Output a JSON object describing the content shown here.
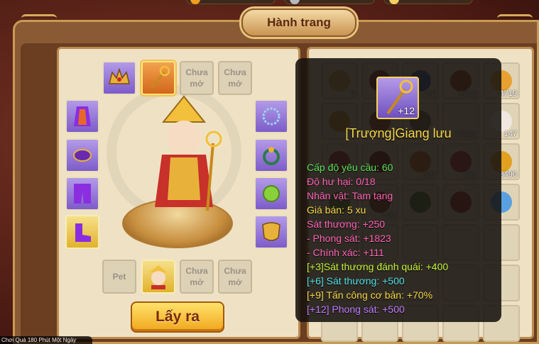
{
  "window": {
    "title": "Hành trang"
  },
  "equipment": {
    "locked_label": "Chưa mở",
    "pet_label": "Pet",
    "take_out_button": "Lấy ra",
    "slots": [
      {
        "id": "crown",
        "state": "filled",
        "icon": "crown-icon"
      },
      {
        "id": "staff",
        "state": "selected",
        "icon": "staff-icon"
      },
      {
        "id": "locked-1",
        "state": "locked"
      },
      {
        "id": "locked-2",
        "state": "locked"
      },
      {
        "id": "robe",
        "state": "filled",
        "icon": "robe-icon"
      },
      {
        "id": "belt",
        "state": "filled",
        "icon": "belt-icon"
      },
      {
        "id": "pants",
        "state": "filled",
        "icon": "pants-icon"
      },
      {
        "id": "boots",
        "state": "gold",
        "icon": "boots-icon"
      },
      {
        "id": "necklace",
        "state": "filled",
        "icon": "necklace-icon"
      },
      {
        "id": "ring",
        "state": "filled",
        "icon": "ring-icon"
      },
      {
        "id": "charm",
        "state": "filled",
        "icon": "charm-icon"
      },
      {
        "id": "mask",
        "state": "filled",
        "icon": "mask-icon"
      },
      {
        "id": "pet",
        "state": "pet"
      },
      {
        "id": "portrait",
        "state": "portrait",
        "icon": "character-portrait-icon"
      },
      {
        "id": "locked-3",
        "state": "locked"
      },
      {
        "id": "locked-4",
        "state": "locked"
      }
    ]
  },
  "bag": {
    "cells": [
      {
        "count": "0",
        "icon": "bowl-icon"
      },
      {
        "count": "",
        "icon": "scroll-icon"
      },
      {
        "count": "245",
        "icon": "cloth-icon"
      },
      {
        "count": "4316",
        "icon": "meat-icon"
      },
      {
        "count": "4719",
        "icon": "ginger-icon"
      },
      {
        "count": "0",
        "icon": "bowl-icon"
      },
      {
        "count": "",
        "icon": "item-icon"
      },
      {
        "count": "",
        "icon": "item-icon"
      },
      {
        "count": "10816",
        "icon": "bun-icon"
      },
      {
        "count": "147",
        "icon": "rice-bag-icon"
      },
      {
        "count": "",
        "icon": "item-icon"
      },
      {
        "count": "",
        "icon": "item-icon"
      },
      {
        "count": "307",
        "icon": "card-icon"
      },
      {
        "count": "233",
        "icon": "new-card-icon"
      },
      {
        "count": "3490",
        "icon": "gourd-icon"
      },
      {
        "count": "",
        "icon": "item-icon"
      },
      {
        "count": "160",
        "icon": "item-icon"
      },
      {
        "count": "",
        "icon": "seed-icon"
      },
      {
        "count": "",
        "icon": "bag-icon"
      },
      {
        "count": "",
        "icon": "orb-icon"
      }
    ]
  },
  "tooltip": {
    "plus": "+12",
    "name": "[Trượng]Giang lưu",
    "lines": [
      {
        "text": "Cấp độ yêu cầu: 60",
        "color": "#5ee05a"
      },
      {
        "text": "Độ hư hại: 0/18",
        "color": "#ff63b6"
      },
      {
        "text": "Nhân vật: Tam tạng",
        "color": "#ff63b6"
      },
      {
        "text": "Giá bán: 5 xu",
        "color": "#f7d84a"
      },
      {
        "text": "Sát thương: +250",
        "color": "#ff63b6"
      },
      {
        "text": "- Phong sát: +1823",
        "color": "#ff63b6"
      },
      {
        "text": "- Chính xác: +111",
        "color": "#ff63b6"
      },
      {
        "text": "[+3]Sát thương đánh quái: +400",
        "color": "#c6f43a"
      },
      {
        "text": "[+6] Sát thương: +500",
        "color": "#4fe0e8"
      },
      {
        "text": "[+9] Tấn công cơ bản: +70%",
        "color": "#f7d84a"
      },
      {
        "text": "[+12] Phong sát: +500",
        "color": "#c07cff"
      }
    ]
  },
  "footer": {
    "text": "Chơi Quá 180 Phút Một Ngày"
  }
}
